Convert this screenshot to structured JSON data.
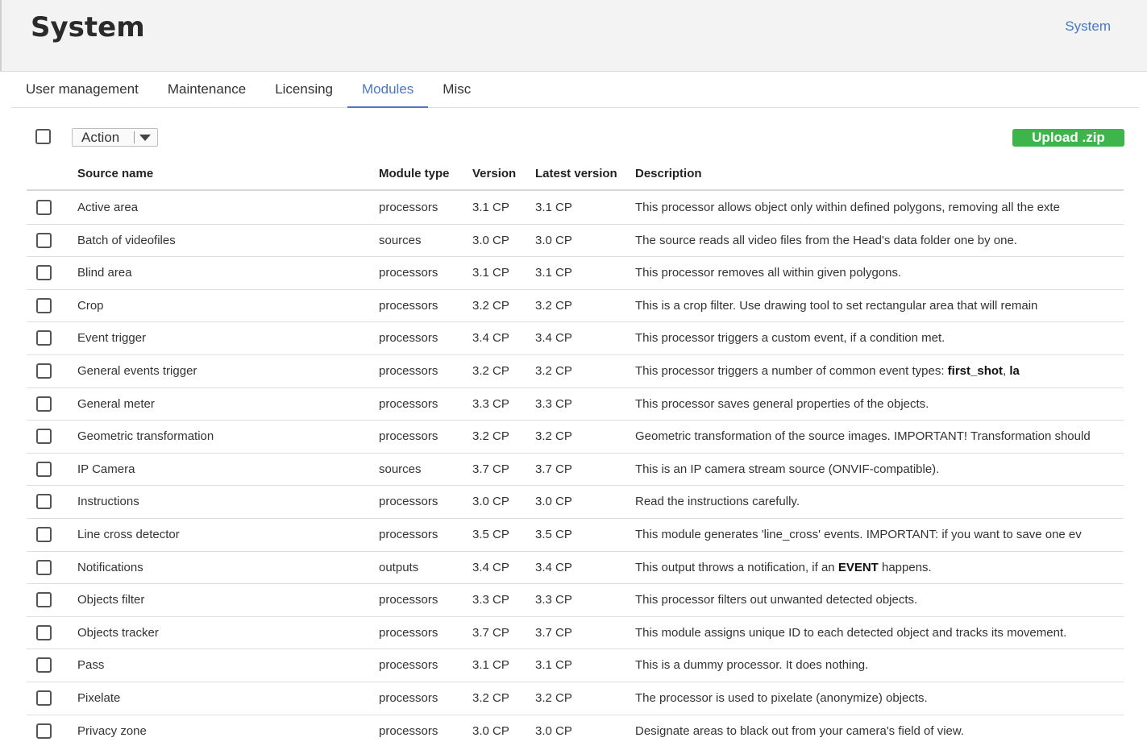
{
  "header": {
    "title": "System",
    "breadcrumb": "System"
  },
  "tabs": [
    {
      "label": "User management"
    },
    {
      "label": "Maintenance"
    },
    {
      "label": "Licensing"
    },
    {
      "label": "Modules"
    },
    {
      "label": "Misc"
    }
  ],
  "active_tab": "Modules",
  "toolbar": {
    "action_label": "Action",
    "upload_label": "Upload .zip"
  },
  "colors": {
    "accent": "#4a78c2",
    "upload": "#3db54a"
  },
  "table": {
    "columns": [
      "Source name",
      "Module type",
      "Version",
      "Latest version",
      "Description"
    ],
    "rows": [
      {
        "name": "Active area",
        "type": "processors",
        "version": "3.1 CP",
        "latest": "3.1 CP",
        "description": "This processor allows object only within defined polygons, removing all the exte"
      },
      {
        "name": "Batch of videofiles",
        "type": "sources",
        "version": "3.0 CP",
        "latest": "3.0 CP",
        "description": "The source reads all video files from the Head's data folder one by one."
      },
      {
        "name": "Blind area",
        "type": "processors",
        "version": "3.1 CP",
        "latest": "3.1 CP",
        "description": "This processor removes all within given polygons."
      },
      {
        "name": "Crop",
        "type": "processors",
        "version": "3.2 CP",
        "latest": "3.2 CP",
        "description": "This is a crop filter. Use drawing tool to set rectangular area that will remain"
      },
      {
        "name": "Event trigger",
        "type": "processors",
        "version": "3.4 CP",
        "latest": "3.4 CP",
        "description": "This processor triggers a custom event, if a condition met."
      },
      {
        "name": "General events trigger",
        "type": "processors",
        "version": "3.2 CP",
        "latest": "3.2 CP",
        "description": "This processor triggers a number of common event types: ",
        "bold_parts": [
          "first_shot",
          "la"
        ],
        "bold_sep": ", "
      },
      {
        "name": "General meter",
        "type": "processors",
        "version": "3.3 CP",
        "latest": "3.3 CP",
        "description": "This processor saves general properties of the objects."
      },
      {
        "name": "Geometric transformation",
        "type": "processors",
        "version": "3.2 CP",
        "latest": "3.2 CP",
        "description": "Geometric transformation of the source images. IMPORTANT! Transformation should"
      },
      {
        "name": "IP Camera",
        "type": "sources",
        "version": "3.7 CP",
        "latest": "3.7 CP",
        "description": "This is an IP camera stream source (ONVIF-compatible)."
      },
      {
        "name": "Instructions",
        "type": "processors",
        "version": "3.0 CP",
        "latest": "3.0 CP",
        "description": "Read the instructions carefully."
      },
      {
        "name": "Line cross detector",
        "type": "processors",
        "version": "3.5 CP",
        "latest": "3.5 CP",
        "description": "This module generates 'line_cross' events. IMPORTANT: if you want to save one ev"
      },
      {
        "name": "Notifications",
        "type": "outputs",
        "version": "3.4 CP",
        "latest": "3.4 CP",
        "description": "This output throws a notification, if an ",
        "bold_parts": [
          "EVENT"
        ],
        "suffix": " happens."
      },
      {
        "name": "Objects filter",
        "type": "processors",
        "version": "3.3 CP",
        "latest": "3.3 CP",
        "description": "This processor filters out unwanted detected objects."
      },
      {
        "name": "Objects tracker",
        "type": "processors",
        "version": "3.7 CP",
        "latest": "3.7 CP",
        "description": "This module assigns unique ID to each detected object and tracks its movement."
      },
      {
        "name": "Pass",
        "type": "processors",
        "version": "3.1 CP",
        "latest": "3.1 CP",
        "description": "This is a dummy processor. It does nothing."
      },
      {
        "name": "Pixelate",
        "type": "processors",
        "version": "3.2 CP",
        "latest": "3.2 CP",
        "description": "The processor is used to pixelate (anonymize) objects."
      },
      {
        "name": "Privacy zone",
        "type": "processors",
        "version": "3.0 CP",
        "latest": "3.0 CP",
        "description": "Designate areas to black out from your camera's field of view."
      }
    ]
  }
}
